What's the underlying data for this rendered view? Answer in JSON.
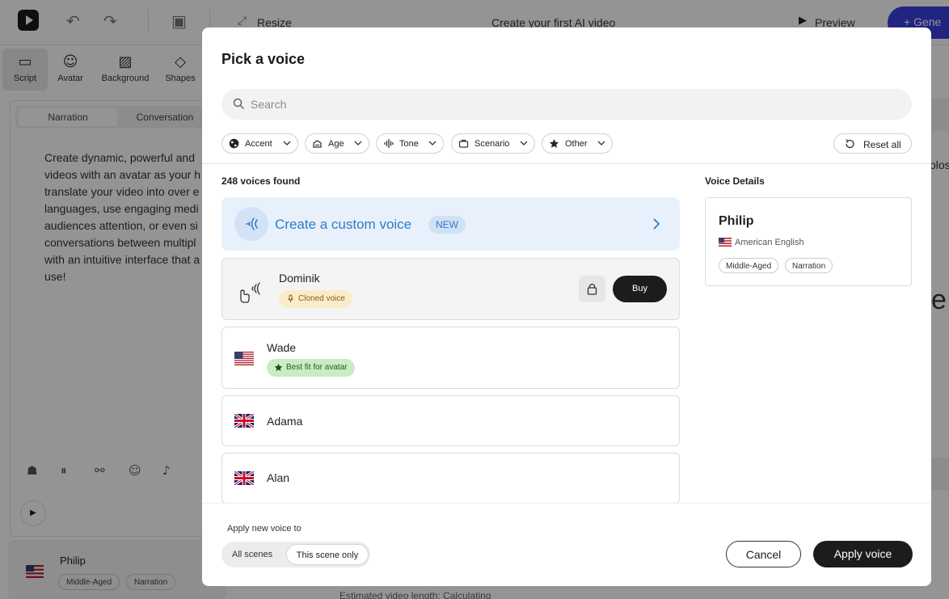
{
  "app": {
    "project_title": "Create your first AI video",
    "resize_label": "Resize",
    "preview_label": "Preview",
    "generate_label": "+ Gene",
    "tools": [
      {
        "label": "Script",
        "icon": "script-icon"
      },
      {
        "label": "Avatar",
        "icon": "avatar-icon"
      },
      {
        "label": "Background",
        "icon": "background-icon"
      },
      {
        "label": "Shapes",
        "icon": "shapes-icon"
      }
    ],
    "script_tabs": {
      "narration": "Narration",
      "conversation": "Conversation"
    },
    "script_text": "Create dynamic, powerful and videos with an avatar as your h translate your video into over e languages, use engaging medi audiences attention, or even si conversations between multipl with an intuitive interface that a use!",
    "current_voice": {
      "name": "Philip",
      "tags": [
        "Middle-Aged",
        "Narration"
      ]
    },
    "right_text_1": "olos",
    "right_text_2": "e",
    "bottom_text": "Estimated video length: Calculating"
  },
  "modal": {
    "title": "Pick a voice",
    "search_placeholder": "Search",
    "filters": [
      {
        "label": "Accent",
        "icon": "globe-icon"
      },
      {
        "label": "Age",
        "icon": "age-icon"
      },
      {
        "label": "Tone",
        "icon": "waveform-icon"
      },
      {
        "label": "Scenario",
        "icon": "briefcase-icon"
      },
      {
        "label": "Other",
        "icon": "star-icon"
      }
    ],
    "reset_label": "Reset all",
    "voices_found": "248 voices found",
    "details_title": "Voice Details",
    "custom_voice": {
      "label": "Create a custom voice",
      "badge": "NEW"
    },
    "voices": [
      {
        "name": "Dominik",
        "badge": "Cloned voice",
        "badge_type": "cloned",
        "buy_label": "Buy",
        "locked": true
      },
      {
        "name": "Wade",
        "badge": "Best fit for avatar",
        "badge_type": "bestfit",
        "flag": "us"
      },
      {
        "name": "Adama",
        "flag": "uk"
      },
      {
        "name": "Alan",
        "flag": "uk"
      }
    ],
    "details": {
      "name": "Philip",
      "accent": "American English",
      "tags": [
        "Middle-Aged",
        "Narration"
      ]
    },
    "apply_to_label": "Apply new voice to",
    "scope_options": {
      "all": "All scenes",
      "this": "This scene only",
      "selected": "this"
    },
    "cancel_label": "Cancel",
    "apply_label": "Apply voice"
  },
  "colors": {
    "accent_blue": "#2f7bc6",
    "custom_bg": "#e8f1fb",
    "cloned_badge_bg": "#fbecc9",
    "bestfit_badge_bg": "#c9ecc3",
    "primary_dark": "#1c1c1c",
    "generate_blue": "#3b3fe0"
  }
}
